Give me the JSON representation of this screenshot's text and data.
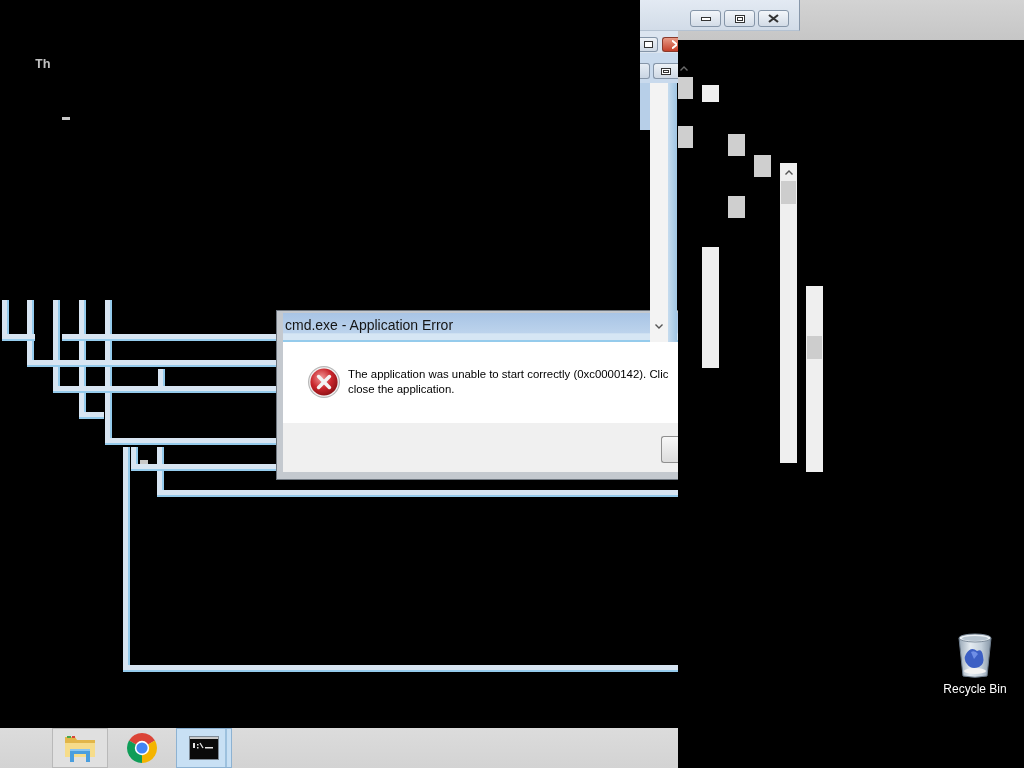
{
  "console": {
    "text": "Th"
  },
  "dialog": {
    "title": "cmd.exe - Application Error",
    "message_lines": [
      "The application was unable to start correctly (0xc0000142). Clic",
      "close the application."
    ]
  },
  "desktop_icons": [
    {
      "label": "Recycle Bin"
    }
  ],
  "taskbar": {
    "items": [
      {
        "kind": "folder",
        "running": true,
        "selected": false
      },
      {
        "kind": "browser",
        "running": false,
        "selected": false
      },
      {
        "kind": "console",
        "running": true,
        "selected": true
      }
    ]
  }
}
